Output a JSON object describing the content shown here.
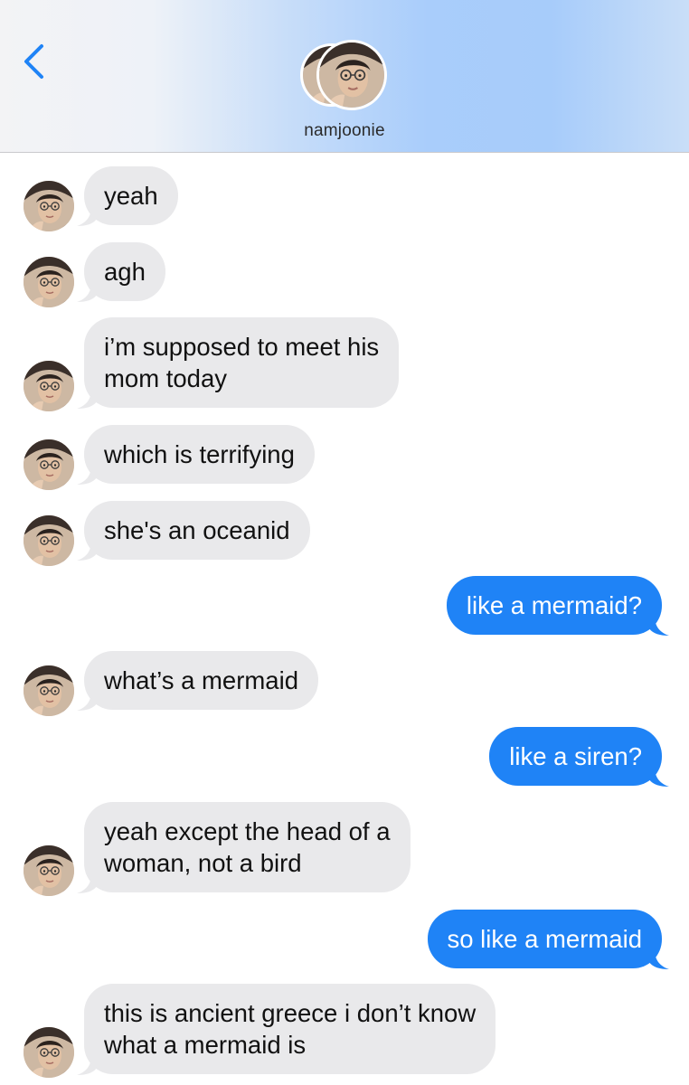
{
  "header": {
    "contact_name": "namjoonie",
    "back_icon": "chevron-left-icon"
  },
  "colors": {
    "incoming_bubble": "#e9e9eb",
    "outgoing_bubble": "#1f83f6",
    "accent": "#1f83f6"
  },
  "messages": [
    {
      "direction": "in",
      "text": "yeah"
    },
    {
      "direction": "in",
      "text": "agh"
    },
    {
      "direction": "in",
      "lines": [
        "i’m supposed to meet his",
        "mom today"
      ]
    },
    {
      "direction": "in",
      "text": "which is terrifying"
    },
    {
      "direction": "in",
      "text": "she's an oceanid"
    },
    {
      "direction": "out",
      "text": "like a mermaid?"
    },
    {
      "direction": "in",
      "text": "what’s a mermaid"
    },
    {
      "direction": "out",
      "text": "like a siren?"
    },
    {
      "direction": "in",
      "lines": [
        "yeah except the head of a",
        "woman, not a bird"
      ]
    },
    {
      "direction": "out",
      "text": "so like a mermaid"
    },
    {
      "direction": "in",
      "lines": [
        "this is ancient greece i don’t know",
        "what a mermaid is"
      ]
    }
  ]
}
